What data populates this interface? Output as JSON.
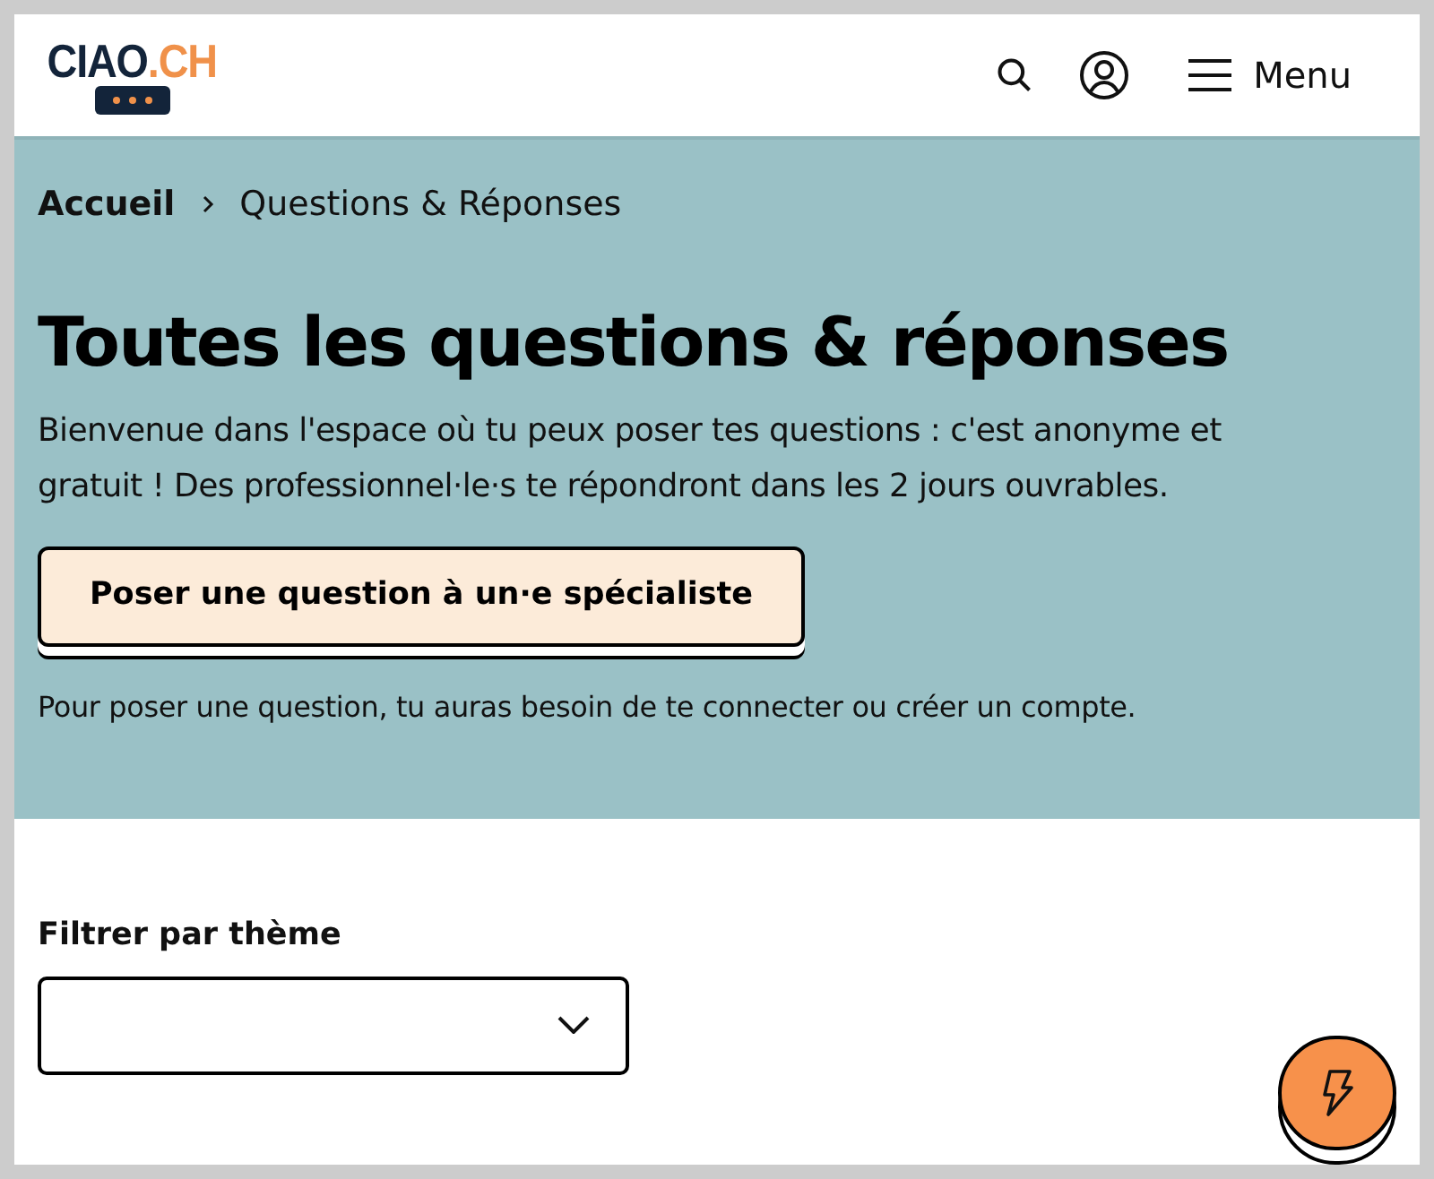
{
  "header": {
    "logo": {
      "main": "CIAO",
      "accent": ".CH"
    },
    "menu_label": "Menu"
  },
  "breadcrumb": [
    {
      "label": "Accueil",
      "current": false
    },
    {
      "label": "Questions & Réponses",
      "current": true
    }
  ],
  "hero": {
    "title": "Toutes les questions & réponses",
    "intro": "Bienvenue dans l'espace où tu peux poser tes questions : c'est anonyme et gratuit ! Des professionnel·le·s te répondront dans les 2 jours ouvrables.",
    "button": "Poser une question à un·e spécialiste",
    "note": "Pour poser une question, tu auras besoin de te connecter ou créer un compte."
  },
  "filter": {
    "label": "Filtrer par thème"
  }
}
